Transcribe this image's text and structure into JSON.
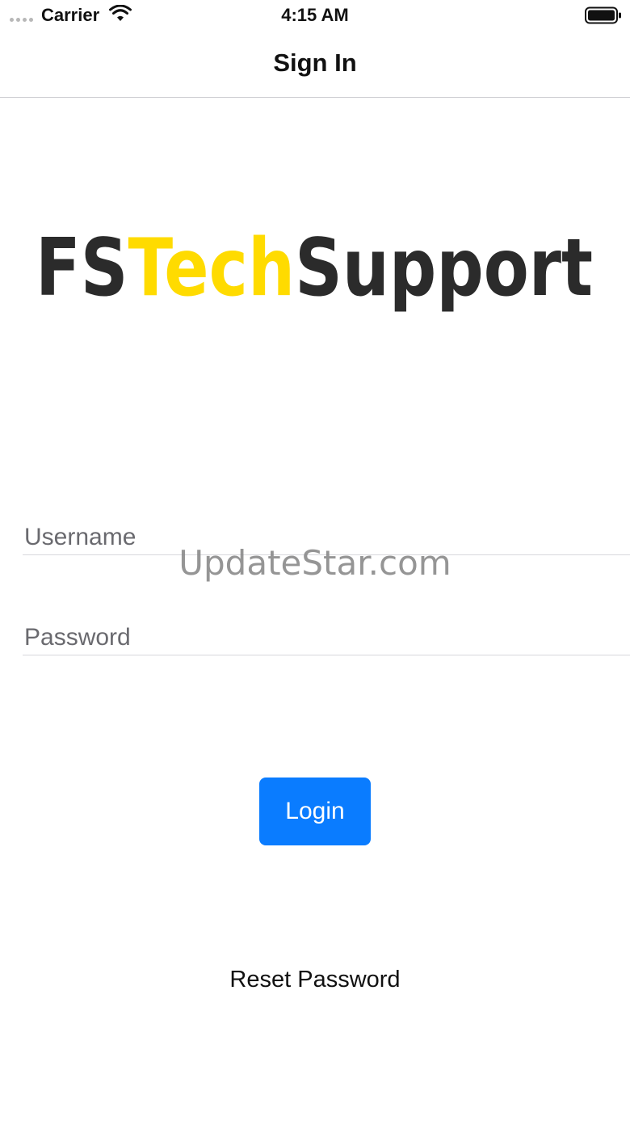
{
  "status_bar": {
    "carrier": "Carrier",
    "time": "4:15 AM"
  },
  "nav": {
    "title": "Sign In"
  },
  "logo": {
    "part_fs": "FS",
    "part_tech": "Tech",
    "part_support": "Support",
    "dark_color": "#2b2b2b",
    "accent_color": "#ffdb00"
  },
  "form": {
    "username_placeholder": "Username",
    "username_value": "",
    "password_placeholder": "Password",
    "password_value": ""
  },
  "actions": {
    "login_label": "Login",
    "reset_label": "Reset Password",
    "accent_color": "#0a7cff"
  },
  "overlay": {
    "watermark_text": "UpdateStar.com"
  }
}
